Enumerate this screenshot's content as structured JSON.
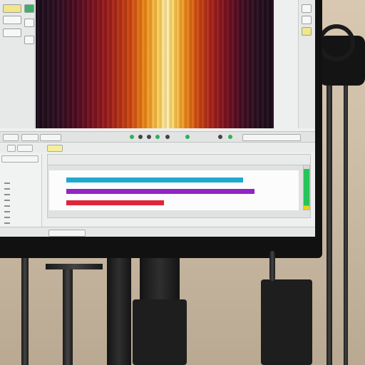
{
  "scene": {
    "monitor_brand": "",
    "colors": {
      "bezel": "#111111",
      "screen_bg": "#eef0ef",
      "track_cyan": "#1fa9cf",
      "track_purple": "#9224c6",
      "track_red": "#e0243a",
      "meter_green": "#27c45a",
      "meter_yellow": "#e8d21a"
    }
  },
  "preview": {
    "description_icon": "spectrum-preview"
  },
  "tracks": [
    {
      "label": "",
      "fill": 0.76,
      "color": "#1fa9cf"
    },
    {
      "label": "",
      "fill": 0.81,
      "color": "#9224c6"
    },
    {
      "label": "",
      "fill": 0.42,
      "color": "#e0243a"
    }
  ],
  "level_meter": {
    "level": 0.92
  }
}
